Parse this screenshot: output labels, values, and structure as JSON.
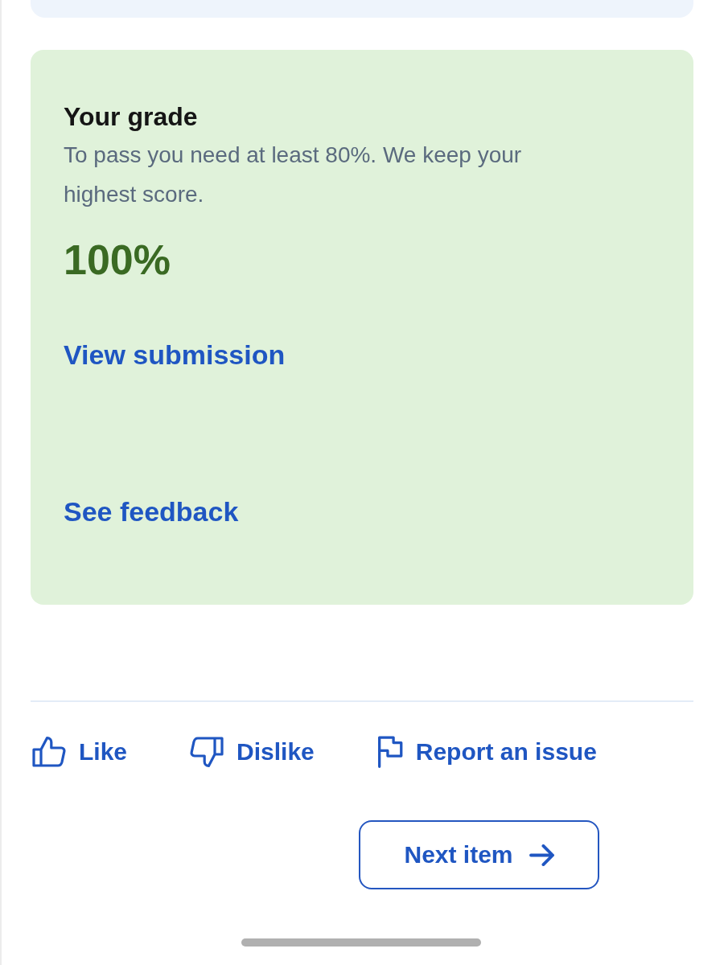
{
  "grade_card": {
    "title": "Your grade",
    "description": "To pass you need at least 80%. We keep your highest score.",
    "passed": true,
    "score": "100%",
    "links": [
      {
        "label": "View submission"
      },
      {
        "label": "See feedback"
      }
    ]
  },
  "feedback_actions": [
    {
      "kind": "like",
      "label": "Like"
    },
    {
      "kind": "dislike",
      "label": "Dislike"
    },
    {
      "kind": "report",
      "label": "Report an issue"
    }
  ],
  "next_button": {
    "label": "Next item"
  }
}
